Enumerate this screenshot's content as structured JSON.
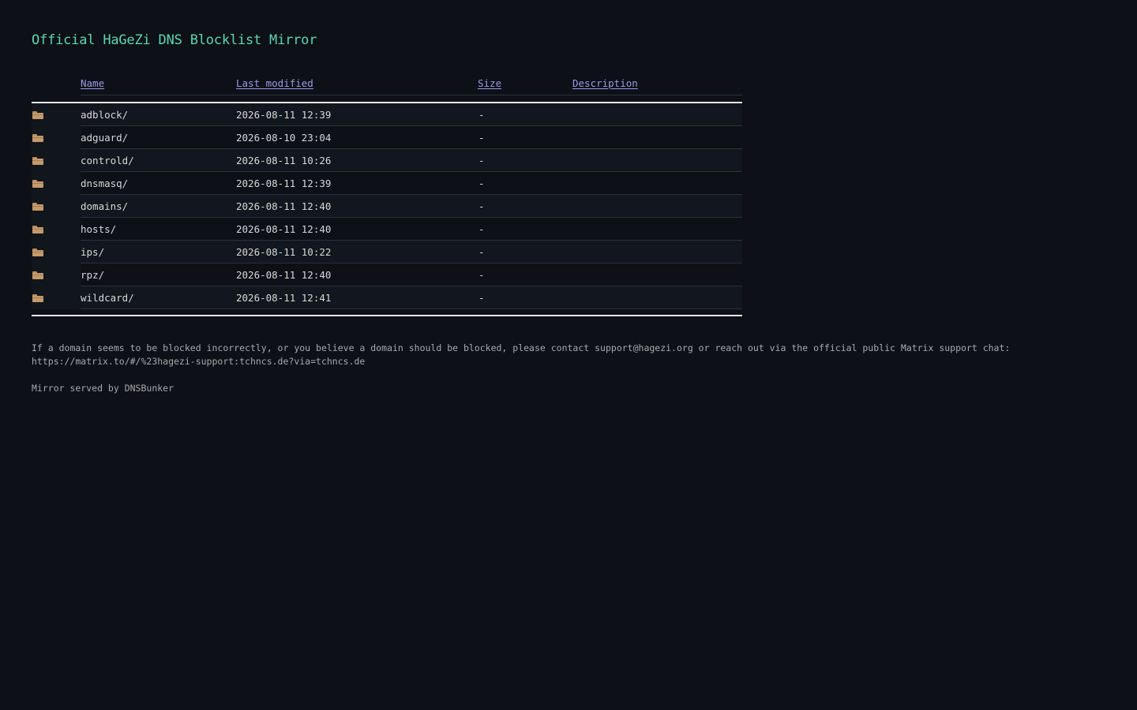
{
  "page": {
    "title": "Official HaGeZi DNS Blocklist Mirror"
  },
  "table": {
    "headers": {
      "name": "Name",
      "last_modified": "Last modified",
      "size": "Size",
      "description": "Description"
    },
    "rows": [
      {
        "name": "adblock/",
        "modified": "2026-08-11 12:39",
        "size": "-",
        "description": ""
      },
      {
        "name": "adguard/",
        "modified": "2026-08-10 23:04",
        "size": "-",
        "description": ""
      },
      {
        "name": "controld/",
        "modified": "2026-08-11 10:26",
        "size": "-",
        "description": ""
      },
      {
        "name": "dnsmasq/",
        "modified": "2026-08-11 12:39",
        "size": "-",
        "description": ""
      },
      {
        "name": "domains/",
        "modified": "2026-08-11 12:40",
        "size": "-",
        "description": ""
      },
      {
        "name": "hosts/",
        "modified": "2026-08-11 12:40",
        "size": "-",
        "description": ""
      },
      {
        "name": "ips/",
        "modified": "2026-08-11 10:22",
        "size": "-",
        "description": ""
      },
      {
        "name": "rpz/",
        "modified": "2026-08-11 12:40",
        "size": "-",
        "description": ""
      },
      {
        "name": "wildcard/",
        "modified": "2026-08-11 12:41",
        "size": "-",
        "description": ""
      }
    ],
    "row_icon": "folder-icon"
  },
  "footer": {
    "contact_text": "If a domain seems to be blocked incorrectly, or you believe a domain should be blocked, please contact support@hagezi.org or reach out via the official public Matrix support chat: https://matrix.to/#/%23hagezi-support:tchncs.de?via=tchncs.de",
    "mirror_text": "Mirror served by DNSBunker"
  },
  "colors": {
    "background": "#0d1017",
    "title": "#5ed6b4",
    "header_link": "#9b9be6",
    "text": "#d8d8d8",
    "folder": "#c49a6c"
  }
}
